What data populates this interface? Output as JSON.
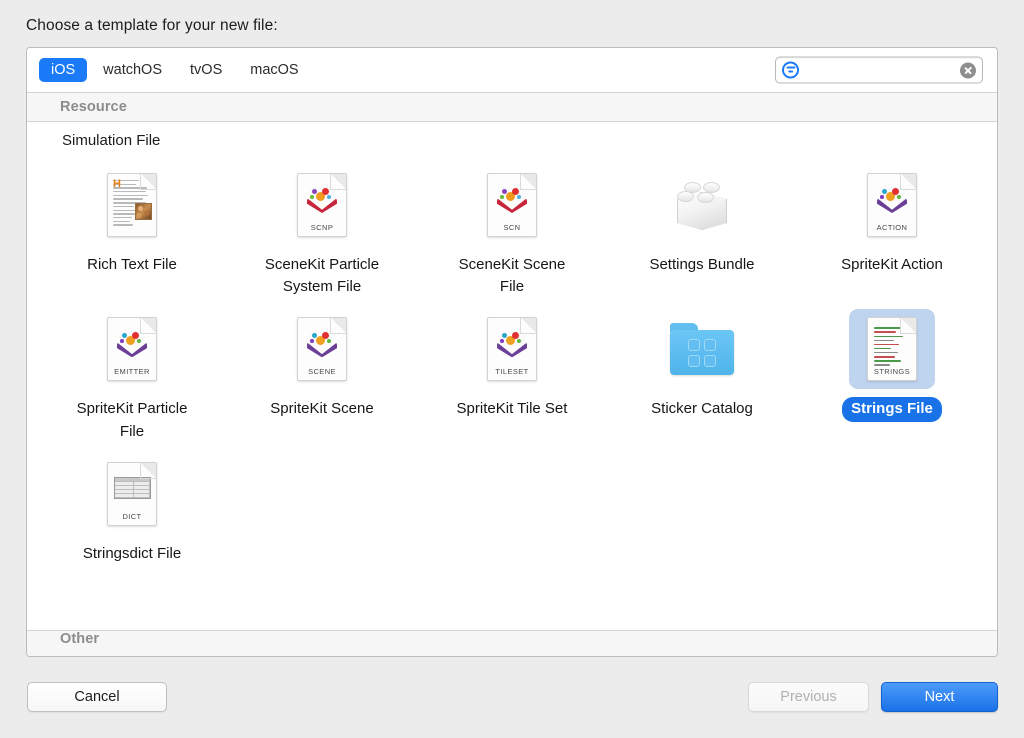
{
  "dialog": {
    "title": "Choose a template for your new file:"
  },
  "toolbar": {
    "tabs": [
      {
        "label": "iOS",
        "active": true
      },
      {
        "label": "watchOS",
        "active": false
      },
      {
        "label": "tvOS",
        "active": false
      },
      {
        "label": "macOS",
        "active": false
      }
    ],
    "search": {
      "value": "",
      "placeholder": "",
      "filter_icon": "filter-icon",
      "clear_icon": "clear-icon"
    }
  },
  "content": {
    "section_header": "Resource",
    "subhead": "Simulation File",
    "bottom_section_header": "Other",
    "templates": [
      {
        "label": "Rich Text File",
        "icon": "rich-text-file-icon",
        "tag": "",
        "selected": false
      },
      {
        "label": "SceneKit Particle System File",
        "icon": "scenekit-particle-icon",
        "tag": "SCNP",
        "selected": false
      },
      {
        "label": "SceneKit Scene File",
        "icon": "scenekit-scene-icon",
        "tag": "SCN",
        "selected": false
      },
      {
        "label": "Settings Bundle",
        "icon": "settings-bundle-icon",
        "tag": "",
        "selected": false
      },
      {
        "label": "SpriteKit Action",
        "icon": "spritekit-action-icon",
        "tag": "ACTION",
        "selected": false
      },
      {
        "label": "SpriteKit Particle File",
        "icon": "spritekit-particle-icon",
        "tag": "EMITTER",
        "selected": false
      },
      {
        "label": "SpriteKit Scene",
        "icon": "spritekit-scene-icon",
        "tag": "SCENE",
        "selected": false
      },
      {
        "label": "SpriteKit Tile Set",
        "icon": "spritekit-tileset-icon",
        "tag": "TILESET",
        "selected": false
      },
      {
        "label": "Sticker Catalog",
        "icon": "sticker-catalog-icon",
        "tag": "",
        "selected": false
      },
      {
        "label": "Strings File",
        "icon": "strings-file-icon",
        "tag": "STRINGS",
        "selected": true
      },
      {
        "label": "Stringsdict File",
        "icon": "stringsdict-file-icon",
        "tag": "DICT",
        "selected": false
      }
    ]
  },
  "footer": {
    "cancel_label": "Cancel",
    "previous_label": "Previous",
    "previous_disabled": true,
    "next_label": "Next"
  },
  "colors": {
    "accent": "#1a7af8",
    "selection_fill": "#bed4ef",
    "selection_pill": "#1a72e8",
    "window_bg": "#ececec",
    "panel_bg": "#ffffff",
    "section_header_text": "#8c8c8c"
  }
}
